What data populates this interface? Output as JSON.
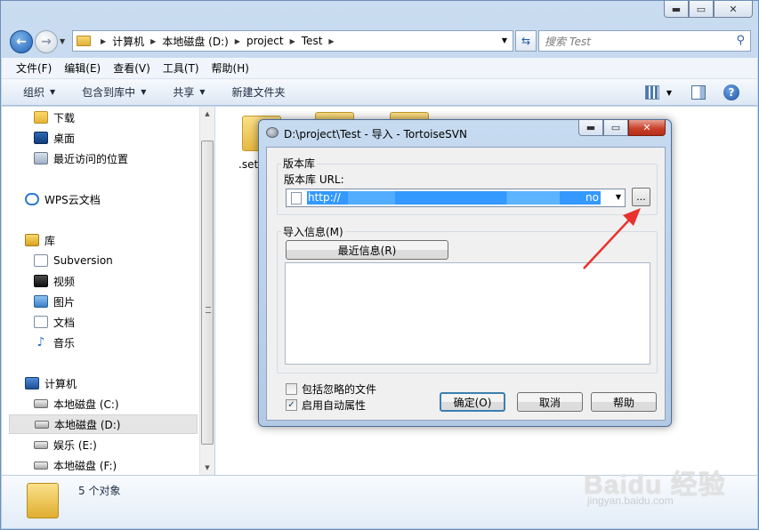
{
  "explorer": {
    "caption": {
      "minimize": "▬",
      "maximize": "▭",
      "close": "✕"
    },
    "address": {
      "crumbs": [
        "计算机",
        "本地磁盘 (D:)",
        "project",
        "Test"
      ]
    },
    "search": {
      "placeholder": "搜索 Test"
    },
    "menu": [
      "文件(F)",
      "编辑(E)",
      "查看(V)",
      "工具(T)",
      "帮助(H)"
    ],
    "toolbar": {
      "organize": "组织",
      "include_library": "包含到库中",
      "share": "共享",
      "new_folder": "新建文件夹"
    },
    "nav": {
      "downloads": "下载",
      "desktop": "桌面",
      "recent": "最近访问的位置",
      "wps_cloud": "WPS云文档",
      "libraries": "库",
      "subversion": "Subversion",
      "videos": "视频",
      "pictures": "图片",
      "documents": "文档",
      "music": "音乐",
      "computer": "计算机",
      "drive_c": "本地磁盘 (C:)",
      "drive_d": "本地磁盘 (D:)",
      "drive_e": "娱乐 (E:)",
      "drive_f": "本地磁盘 (F:)"
    },
    "content": {
      "file1": ".sett"
    },
    "status": {
      "count": "5 个对象"
    }
  },
  "dialog": {
    "title": "D:\\project\\Test - 导入 - TortoiseSVN",
    "repo_group": "版本库",
    "repo_url_label": "版本库 URL:",
    "repo_url_value": "http://",
    "repo_url_tail": "no",
    "browse_label": "...",
    "import_msg_group": "导入信息(M)",
    "recent_msgs_btn": "最近信息(R)",
    "include_ignored": "包括忽略的文件",
    "enable_autoprops": "启用自动属性",
    "include_ignored_checked": false,
    "enable_autoprops_checked": true,
    "ok": "确定(O)",
    "cancel": "取消",
    "help": "帮助"
  },
  "watermark": {
    "text": "Baidu 经验",
    "sub": "jingyan.baidu.com"
  },
  "colors": {
    "selection": "#3399ff",
    "annotation_arrow": "#e8322d",
    "dialog_close": "#c8412a"
  }
}
